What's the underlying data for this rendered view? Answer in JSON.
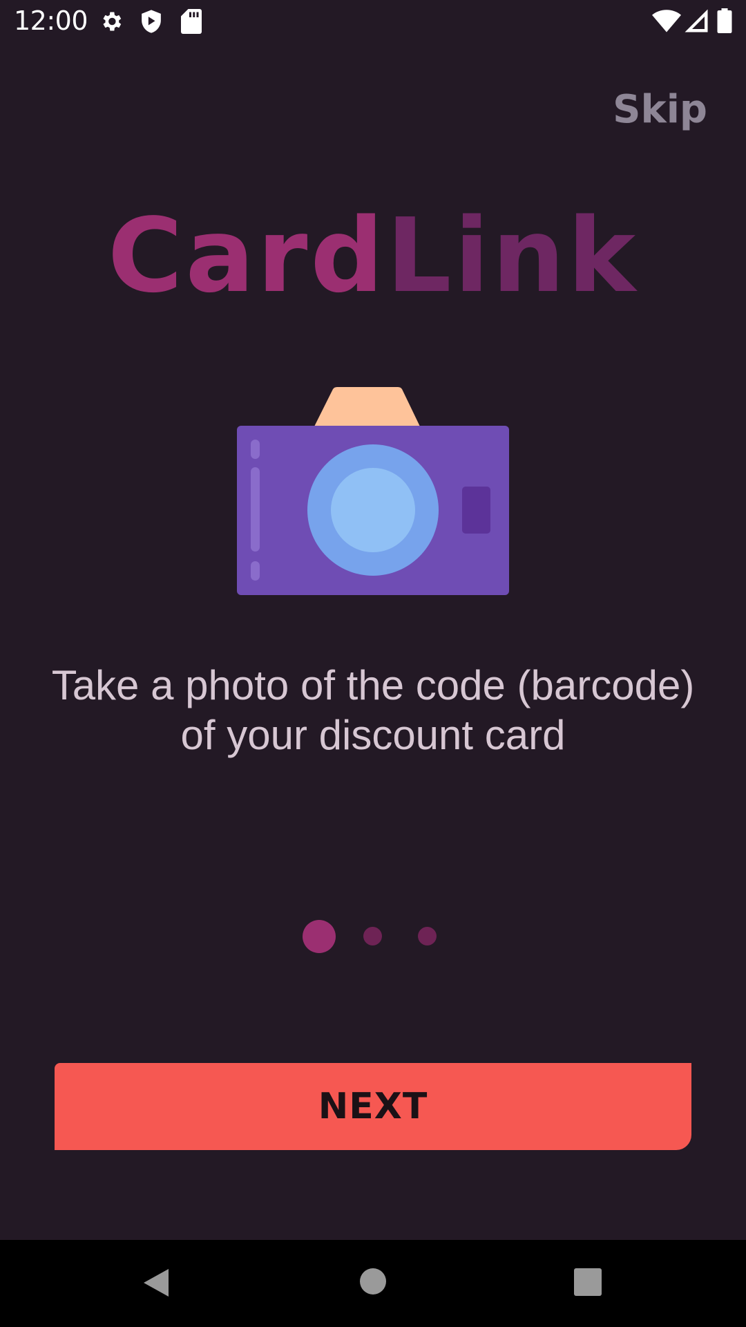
{
  "status_bar": {
    "time": "12:00",
    "icons": [
      "gear-icon",
      "shield-play-icon",
      "sd-card-icon",
      "wifi-icon",
      "signal-icon",
      "battery-icon"
    ]
  },
  "header": {
    "skip_label": "Skip"
  },
  "logo": {
    "part1": "Card",
    "part2": "Link",
    "color_part1": "#9b2f71",
    "color_part2": "#6e2762"
  },
  "illustration": {
    "icon": "camera-icon"
  },
  "onboarding": {
    "line1": "Take a photo of the code (barcode)",
    "line2": "of your discount card",
    "current_page": 1,
    "total_pages": 3
  },
  "actions": {
    "next_label": "NEXT",
    "next_color": "#f65852"
  },
  "nav_bar": {
    "buttons": [
      "back-icon",
      "home-icon",
      "recents-icon"
    ]
  },
  "colors": {
    "background": "#231925",
    "dot_active": "#9b2f71",
    "dot_inactive": "#6e2355"
  }
}
